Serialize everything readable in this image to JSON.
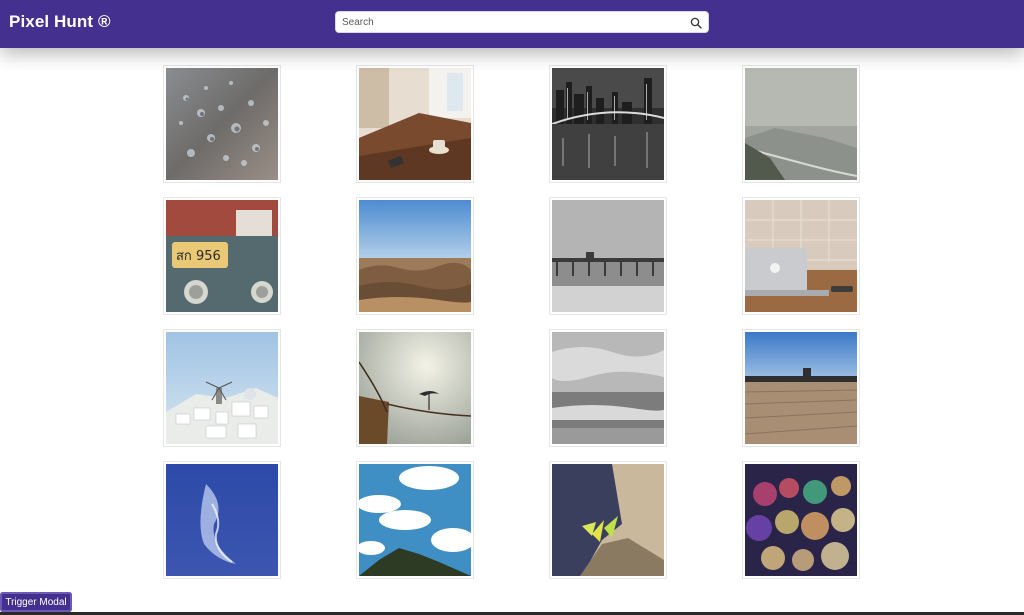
{
  "header": {
    "brand": "Pixel Hunt ®",
    "search_placeholder": "Search",
    "search_icon": "search-icon"
  },
  "gallery": {
    "photos": [
      {
        "subject": "water-droplets"
      },
      {
        "subject": "cafe-table-coffee"
      },
      {
        "subject": "city-bridge-night"
      },
      {
        "subject": "misty-coast"
      },
      {
        "subject": "vintage-car-plate"
      },
      {
        "subject": "desert-hills"
      },
      {
        "subject": "pier-sea"
      },
      {
        "subject": "laptop-desk"
      },
      {
        "subject": "white-village-windmill"
      },
      {
        "subject": "boat-rope-bird"
      },
      {
        "subject": "beach-clouds"
      },
      {
        "subject": "wooden-deck-horizon"
      },
      {
        "subject": "blue-sky-light"
      },
      {
        "subject": "clouds-hill"
      },
      {
        "subject": "plant-rock-water"
      },
      {
        "subject": "bokeh-lights"
      }
    ]
  },
  "footer": {
    "modal_button": "Trigger Modal"
  }
}
